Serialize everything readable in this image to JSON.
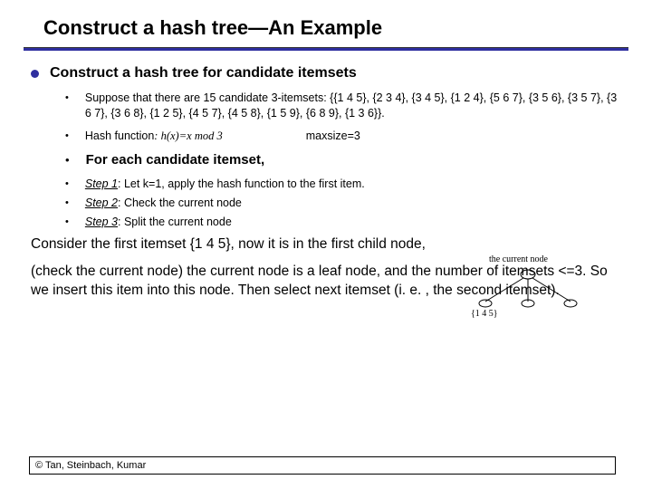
{
  "title": "Construct a hash tree—An Example",
  "heading": "Construct a hash tree for candidate itemsets",
  "b1": "Suppose that there are 15 candidate 3-itemsets: {{1 4 5}, {2 3 4}, {3 4 5}, {1 2 4}, {5 6 7}, {3 5 6}, {3 5 7}, {3 6 7}, {3 6 8}, {1 2 5}, {4 5 7}, {4 5 8}, {1 5 9}, {6 8 9}, {1 3 6}}.",
  "b2_prefix": "Hash function",
  "b2_colon": ": ",
  "b2_fn": "h(x)=x mod 3",
  "b2_max": "maxsize=3",
  "b3": "For each candidate itemset,",
  "s1_label": "Step 1",
  "s1_text": ": Let k=1, apply the hash function to the first item.",
  "s2_label": "Step 2",
  "s2_text": ": Check the current node",
  "s3_label": "Step 3",
  "s3_text": ": Split the current node",
  "para1": "Consider the first itemset {1 4 5}, now it is in the first child node,",
  "para2": "(check the current node) the current node is a leaf node, and the number of itemsets <=3. So we insert this item into this node. Then select next itemset (i. e. , the second itemset).",
  "diagram_top": "the current node",
  "diagram_leaf": "{1 4 5}",
  "footer": "© Tan, Steinbach, Kumar"
}
